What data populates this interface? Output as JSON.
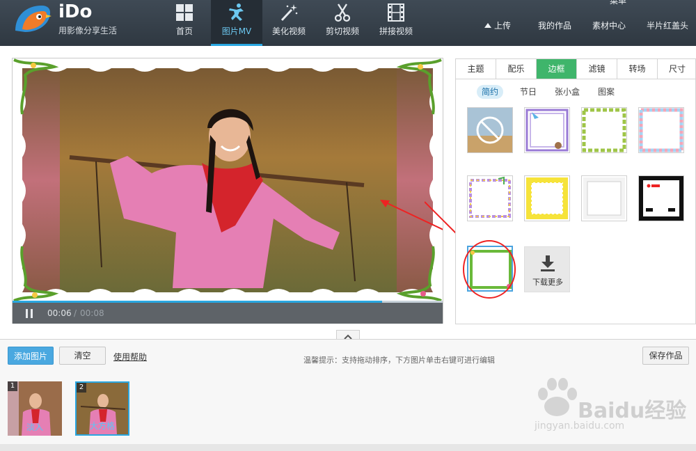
{
  "app": {
    "name": "iDo",
    "tagline": "用影像分享生活"
  },
  "nav": [
    {
      "label": "首页",
      "icon": "grid-icon"
    },
    {
      "label": "图片MV",
      "icon": "dancer-icon",
      "active": true
    },
    {
      "label": "美化视频",
      "icon": "magic-wand-icon"
    },
    {
      "label": "剪切视频",
      "icon": "scissors-icon"
    },
    {
      "label": "拼接视频",
      "icon": "film-strip-icon"
    }
  ],
  "top_links": {
    "menu": "菜单",
    "upload": "上传",
    "my_works": "我的作品",
    "materials": "素材中心",
    "opening_ending": "半片红盖头"
  },
  "player": {
    "current_time": "00:06",
    "separator": "/",
    "total_time": "00:08",
    "progress": 0.86
  },
  "panel": {
    "tabs": [
      "主题",
      "配乐",
      "边框",
      "滤镜",
      "转场",
      "尺寸"
    ],
    "active_tab": "边框",
    "subtabs": [
      "简约",
      "节日",
      "张小盒",
      "图案"
    ],
    "active_subtab": "简约",
    "frames": [
      {
        "name": "no-frame"
      },
      {
        "name": "bird-purple-frame"
      },
      {
        "name": "leaf-green-frame"
      },
      {
        "name": "pastel-dots-frame"
      },
      {
        "name": "ribbon-music-frame"
      },
      {
        "name": "yellow-stamp-frame"
      },
      {
        "name": "white-simple-frame"
      },
      {
        "name": "rec-camera-frame"
      },
      {
        "name": "green-vine-frame",
        "selected": true
      }
    ],
    "download_more": "下载更多"
  },
  "toolbar": {
    "add_image": "添加图片",
    "clear": "清空",
    "help": "使用帮助",
    "hint": "温馨提示：支持拖动排序，下方图片单击右键可进行编辑",
    "save": "保存作品"
  },
  "filmstrip": [
    {
      "index": "1",
      "label": "淡入"
    },
    {
      "index": "2",
      "label": "大方格",
      "selected": true
    }
  ],
  "watermark": {
    "main": "Baidu经验",
    "url": "jingyan.baidu.com"
  },
  "colors": {
    "accent": "#29a7e1",
    "tab_active": "#3fb56b",
    "topbar": "#343e48"
  }
}
